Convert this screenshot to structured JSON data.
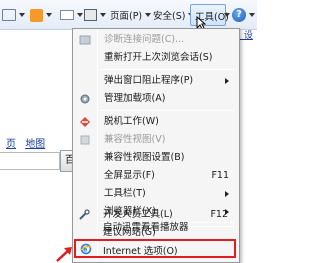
{
  "toolbar": {
    "page_label": "页面(P)",
    "safety_label": "安全(S)",
    "tools_label": "工具(O)",
    "help_symbol": "?"
  },
  "background": {
    "right_text": "页 设",
    "map_links": [
      "页",
      "地图"
    ],
    "baidu_button": "百度"
  },
  "menu": {
    "items": [
      {
        "label": "诊断连接问题(C)...",
        "shortcut": "",
        "submenu": false,
        "disabled": true,
        "icon": "diagnose-icon"
      },
      {
        "label": "重新打开上次浏览会话(S)",
        "shortcut": "",
        "submenu": false,
        "disabled": false,
        "icon": ""
      },
      {
        "label": "弹出窗口阻止程序(P)",
        "shortcut": "",
        "submenu": true,
        "disabled": false,
        "icon": ""
      },
      {
        "label": "管理加载项(A)",
        "shortcut": "",
        "submenu": false,
        "disabled": false,
        "icon": "gear-icon"
      },
      {
        "label": "脱机工作(W)",
        "shortcut": "",
        "submenu": false,
        "disabled": false,
        "icon": "offline-icon"
      },
      {
        "label": "兼容性视图(V)",
        "shortcut": "",
        "submenu": false,
        "disabled": true,
        "icon": "compat-icon"
      },
      {
        "label": "兼容性视图设置(B)",
        "shortcut": "",
        "submenu": false,
        "disabled": false,
        "icon": ""
      },
      {
        "label": "全屏显示(F)",
        "shortcut": "F11",
        "submenu": false,
        "disabled": false,
        "icon": ""
      },
      {
        "label": "工具栏(T)",
        "shortcut": "",
        "submenu": true,
        "disabled": false,
        "icon": ""
      },
      {
        "label": "浏览器栏(X)",
        "shortcut": "",
        "submenu": true,
        "disabled": false,
        "icon": ""
      },
      {
        "label": "开发人员工具(L)",
        "shortcut": "F12",
        "submenu": false,
        "disabled": false,
        "icon": "devtools-icon"
      },
      {
        "label": "建议网站(G)",
        "shortcut": "",
        "submenu": false,
        "disabled": false,
        "icon": ""
      },
      {
        "label": "启动迅雷看看播放器",
        "shortcut": "",
        "submenu": false,
        "disabled": false,
        "icon": ""
      },
      {
        "label": "Internet 选项(O)",
        "shortcut": "",
        "submenu": false,
        "disabled": false,
        "icon": "internet-options-icon"
      }
    ]
  },
  "colors": {
    "highlight_border": "#e01e1e",
    "menu_bg": "#f5f5f5",
    "link": "#1a3fa0"
  }
}
